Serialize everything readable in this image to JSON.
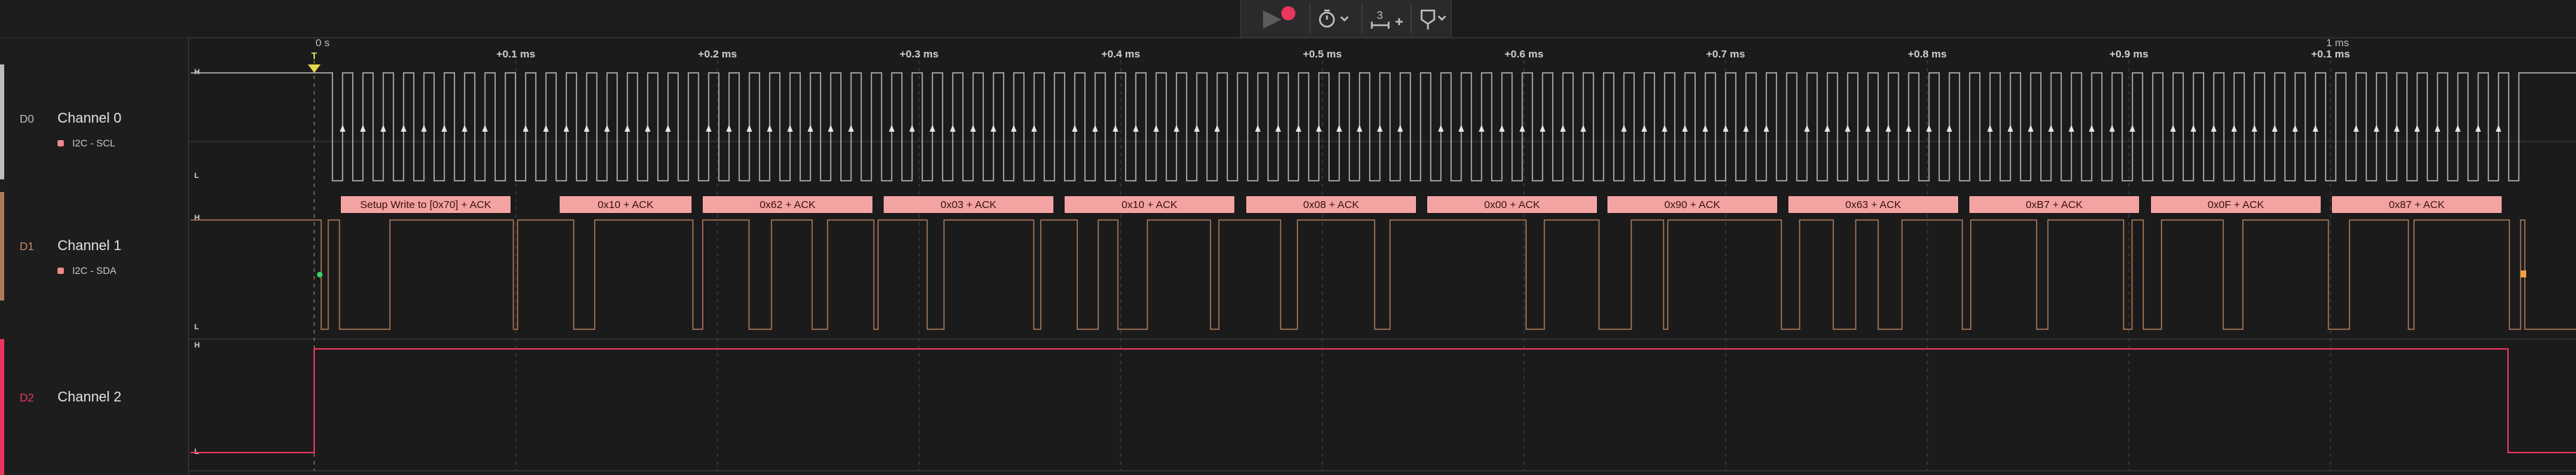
{
  "toolbar": {
    "record_step": "3",
    "colors": {
      "record": "#e8365e"
    }
  },
  "timeline": {
    "zero_label": "0 s",
    "trigger_label": "T",
    "ticks": [
      "+0.1 ms",
      "+0.2 ms",
      "+0.3 ms",
      "+0.4 ms",
      "+0.5 ms",
      "+0.6 ms",
      "+0.7 ms",
      "+0.8 ms",
      "+0.9 ms",
      "+0.1 ms"
    ],
    "major_label": "1 ms"
  },
  "channels": [
    {
      "id": "D0",
      "name": "Channel 0",
      "analyzer": "I2C - SCL",
      "color": "#bdbdbd",
      "high": "H",
      "low": "L"
    },
    {
      "id": "D1",
      "name": "Channel 1",
      "analyzer": "I2C - SDA",
      "color": "#b07a5a",
      "high": "H",
      "low": "L"
    },
    {
      "id": "D2",
      "name": "Channel 2",
      "color": "#e8365e",
      "high": "H",
      "low": "L"
    }
  ],
  "frames": [
    "Setup Write to [0x70] + ACK",
    "0x10 + ACK",
    "0x62 + ACK",
    "0x03 + ACK",
    "0x10 + ACK",
    "0x08 + ACK",
    "0x00 + ACK",
    "0x90 + ACK",
    "0x63 + ACK",
    "0xB7 + ACK",
    "0x0F + ACK",
    "0x87 + ACK"
  ],
  "frame_colors": {
    "fill": "#f4a3a3",
    "text": "#3a1010"
  },
  "icons": [
    "play-icon",
    "record-icon",
    "timer-icon",
    "chevron-down-icon",
    "measure-icon",
    "plus-icon",
    "marker-icon",
    "chevron-down-icon"
  ]
}
